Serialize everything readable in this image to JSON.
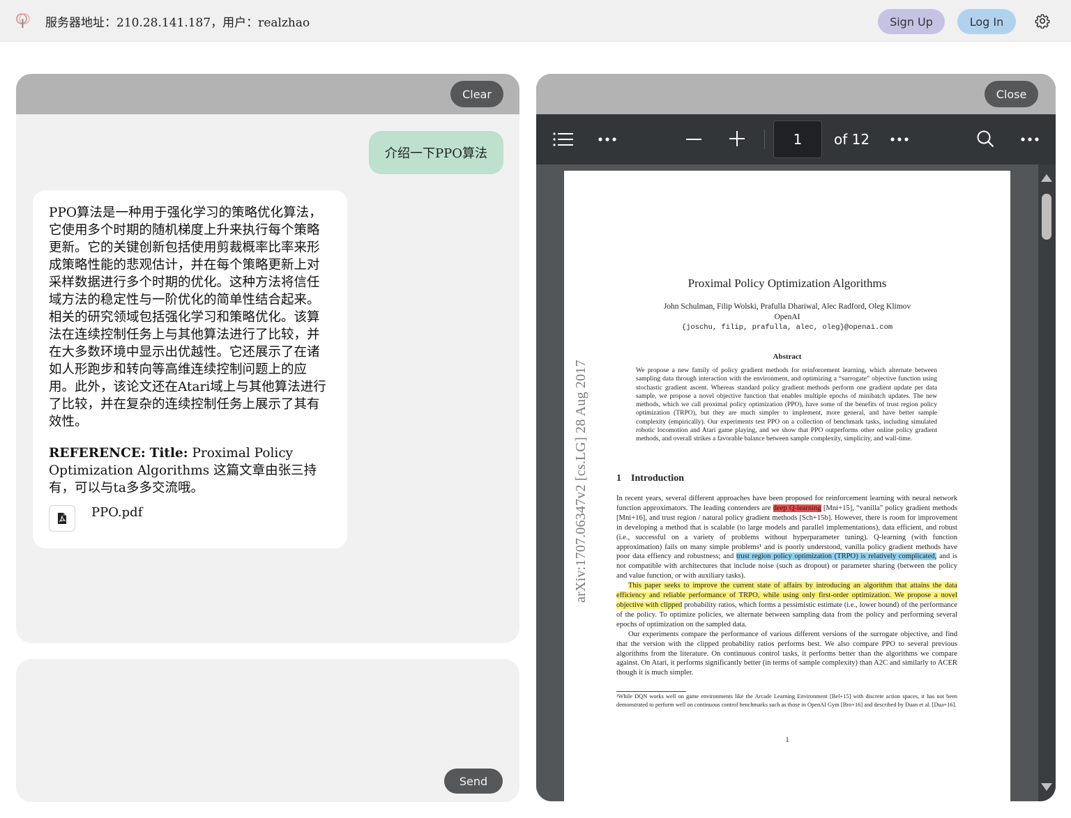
{
  "topbar": {
    "server_info": "服务器地址：210.28.141.187，用户：realzhao",
    "signup_label": "Sign Up",
    "login_label": "Log In"
  },
  "chat": {
    "clear_label": "Clear",
    "user_message": "介绍一下PPO算法",
    "bot_message": "PPO算法是一种用于强化学习的策略优化算法，它使用多个时期的随机梯度上升来执行每个策略更新。它的关键创新包括使用剪裁概率比率来形成策略性能的悲观估计，并在每个策略更新上对采样数据进行多个时期的优化。这种方法将信任域方法的稳定性与一阶优化的简单性结合起来。相关的研究领域包括强化学习和策略优化。该算法在连续控制任务上与其他算法进行了比较，并在大多数环境中显示出优越性。它还展示了在诸如人形跑步和转向等高维连续控制问题上的应用。此外，该论文还在Atari域上与其他算法进行了比较，并在复杂的连续控制任务上展示了其有效性。",
    "reference_label": "REFERENCE:",
    "reference_title_label": "Title:",
    "reference_text": "Proximal Policy Optimization Algorithms 这篇文章由张三持有，可以与ta多多交流哦。",
    "attachment_name": "PPO.pdf",
    "attachment_icon": "pdf-file-icon"
  },
  "input": {
    "value": "",
    "send_label": "Send"
  },
  "pdf_viewer": {
    "close_label": "Close",
    "current_page": "1",
    "page_of": "of 12",
    "icons": {
      "outline": "list-icon",
      "more": "more-dots-icon",
      "zoom_out": "minus-icon",
      "zoom_in": "plus-icon",
      "search": "search-icon"
    }
  },
  "paper": {
    "arxiv_stamp": "arXiv:1707.06347v2  [cs.LG]  28 Aug 2017",
    "title": "Proximal Policy Optimization Algorithms",
    "authors": "John Schulman, Filip Wolski, Prafulla Dhariwal, Alec Radford, Oleg Klimov",
    "affiliation": "OpenAI",
    "emails": "{joschu, filip, prafulla, alec, oleg}@openai.com",
    "abstract_heading": "Abstract",
    "abstract": "We propose a new family of policy gradient methods for reinforcement learning, which alternate between sampling data through interaction with the environment, and optimizing a “surrogate” objective function using stochastic gradient ascent. Whereas standard policy gradient methods perform one gradient update per data sample, we propose a novel objective function that enables multiple epochs of minibatch updates. The new methods, which we call proximal policy optimization (PPO), have some of the benefits of trust region policy optimization (TRPO), but they are much simpler to implement, more general, and have better sample complexity (empirically). Our experiments test PPO on a collection of benchmark tasks, including simulated robotic locomotion and Atari game playing, and we show that PPO outperforms other online policy gradient methods, and overall strikes a favorable balance between sample complexity, simplicity, and wall-time.",
    "section_number": "1",
    "section_title": "Introduction",
    "intro_p1_a": "In recent years, several different approaches have been proposed for reinforcement learning with neural network function approximators. The leading contenders are ",
    "intro_p1_hl_red": "deep Q-learning",
    "intro_p1_b": " [Mni+15], “vanilla” policy gradient methods [Mni+16], and trust region / natural policy gradient methods [Sch+15b]. However, there is room for improvement in developing a method that is scalable (to large models and parallel implementations), data efficient, and robust (i.e., successful on a variety of problems without hyperparameter tuning). Q-learning (with function approximation) fails on many simple problems¹ and is poorly understood, vanilla policy gradient methods have poor data effiency and robustness; and ",
    "intro_p1_hl_blue": "trust region policy optimization (TRPO) is relatively complicated,",
    "intro_p1_c": " and is not compatible with architectures that include noise (such as dropout) or parameter sharing (between the policy and value function, or with auxiliary tasks).",
    "intro_p2_hl_yellow": "This paper seeks to improve the current state of affairs by introducing an algorithm that attains the data efficiency and reliable performance of TRPO, while using only first-order optimization. We propose a novel objective with clipped",
    "intro_p2_b": " probability ratios, which forms a pessimistic estimate (i.e., lower bound) of the performance of the policy. To optimize policies, we alternate between sampling data from the policy and performing several epochs of optimization on the sampled data.",
    "intro_p3": "Our experiments compare the performance of various different versions of the surrogate objective, and find that the version with the clipped probability ratios performs best. We also compare PPO to several previous algorithms from the literature. On continuous control tasks, it performs better than the algorithms we compare against. On Atari, it performs significantly better (in terms of sample complexity) than A2C and similarly to ACER though it is much simpler.",
    "footnote": "¹While DQN works well on game environments like the Arcade Learning Environment [Bel+15] with discrete action spaces, it has not been demonstrated to perform well on continuous control benchmarks such as those in OpenAI Gym [Bro+16] and described by Duan et al. [Dua+16].",
    "page_number": "1"
  }
}
